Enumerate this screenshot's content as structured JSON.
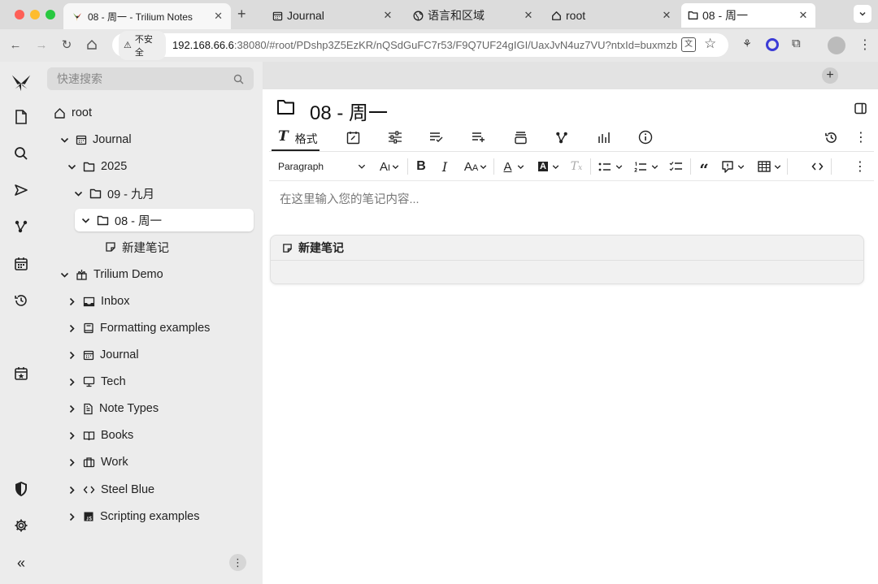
{
  "browser": {
    "tab_title": "08 - 周一 - Trilium Notes",
    "new_tab": "+",
    "security_label": "不安全",
    "url_host": "192.168.66.6",
    "url_rest": ":38080/#root/PDshp3Z5EzKR/nQSdGuFC7r53/F9Q7UF24gIGI/UaxJvN4uz7VU?ntxId=buxmzb"
  },
  "sidebar": {
    "search_placeholder": "快速搜索",
    "tree": [
      {
        "label": "root",
        "icon": "home-icon"
      },
      {
        "label": "Journal",
        "icon": "calendar-icon"
      },
      {
        "label": "2025",
        "icon": "folder-icon"
      },
      {
        "label": "09 - 九月",
        "icon": "folder-icon"
      },
      {
        "label": "08 - 周一",
        "icon": "folder-icon"
      },
      {
        "label": "新建笔记",
        "icon": "note-icon"
      },
      {
        "label": "Trilium Demo",
        "icon": "demo-icon"
      },
      {
        "label": "Inbox",
        "icon": "inbox-icon"
      },
      {
        "label": "Formatting examples",
        "icon": "book-icon"
      },
      {
        "label": "Journal",
        "icon": "calendar-icon"
      },
      {
        "label": "Tech",
        "icon": "monitor-icon"
      },
      {
        "label": "Note Types",
        "icon": "file-icon"
      },
      {
        "label": "Books",
        "icon": "open-book-icon"
      },
      {
        "label": "Work",
        "icon": "briefcase-icon"
      },
      {
        "label": "Steel Blue",
        "icon": "code-icon"
      },
      {
        "label": "Scripting examples",
        "icon": "js-icon"
      }
    ]
  },
  "note_tabs": [
    {
      "label": "Journal",
      "icon": "calendar-icon"
    },
    {
      "label": "语言和区域",
      "icon": "globe-icon"
    },
    {
      "label": "root",
      "icon": "home-icon"
    },
    {
      "label": "08 - 周一",
      "icon": "folder-icon"
    }
  ],
  "note": {
    "title": "08 - 周一",
    "ribbon_format_label": "格式",
    "paragraph_select": "Paragraph",
    "editor_placeholder": "在这里输入您的笔记内容...",
    "child_card_title": "新建笔记"
  },
  "colors": {
    "accent": "#222222",
    "sidebar_bg": "#ececec",
    "active_node_bg": "#ffffff"
  }
}
